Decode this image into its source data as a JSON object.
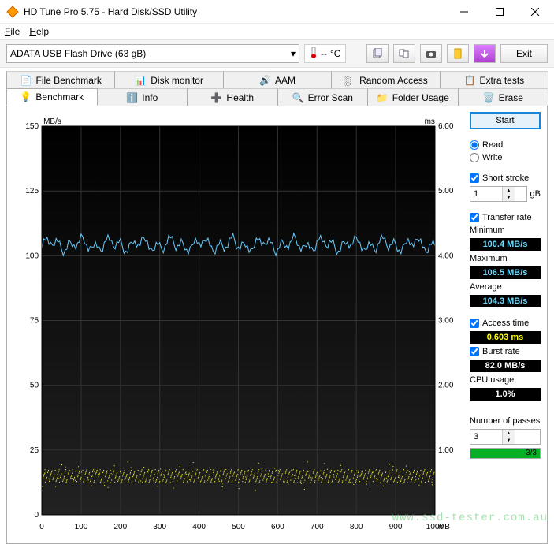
{
  "window": {
    "title": "HD Tune Pro 5.75 - Hard Disk/SSD Utility"
  },
  "menu": {
    "file": "File",
    "help": "Help"
  },
  "toolbar": {
    "device": "ADATA   USB Flash Drive (63 gB)",
    "temp_dash": "--",
    "temp_unit": "°C",
    "exit": "Exit"
  },
  "tabs_top": [
    {
      "label": "File Benchmark"
    },
    {
      "label": "Disk monitor"
    },
    {
      "label": "AAM"
    },
    {
      "label": "Random Access"
    },
    {
      "label": "Extra tests"
    }
  ],
  "tabs_bottom": [
    {
      "label": "Benchmark"
    },
    {
      "label": "Info"
    },
    {
      "label": "Health"
    },
    {
      "label": "Error Scan"
    },
    {
      "label": "Folder Usage"
    },
    {
      "label": "Erase"
    }
  ],
  "side": {
    "start": "Start",
    "read": "Read",
    "write": "Write",
    "short_stroke": "Short stroke",
    "short_stroke_val": "1",
    "short_stroke_unit": "gB",
    "transfer_rate": "Transfer rate",
    "min_label": "Minimum",
    "min_val": "100.4 MB/s",
    "max_label": "Maximum",
    "max_val": "106.5 MB/s",
    "avg_label": "Average",
    "avg_val": "104.3 MB/s",
    "access_time": "Access time",
    "access_val": "0.603 ms",
    "burst_rate": "Burst rate",
    "burst_val": "82.0 MB/s",
    "cpu_label": "CPU usage",
    "cpu_val": "1.0%",
    "passes_label": "Number of passes",
    "passes_val": "3",
    "progress_txt": "3/3"
  },
  "chart_data": {
    "type": "line+scatter",
    "title": "",
    "x_unit": "mB",
    "y_left_label": "MB/s",
    "y_right_label": "ms",
    "x_ticks": [
      0,
      100,
      200,
      300,
      400,
      500,
      600,
      700,
      800,
      900,
      1000
    ],
    "y_left_ticks": [
      0,
      25,
      50,
      75,
      100,
      125,
      150
    ],
    "y_right_ticks": [
      0,
      1.0,
      2.0,
      3.0,
      4.0,
      5.0,
      6.0
    ],
    "xlim": [
      0,
      1000
    ],
    "ylim_left": [
      0,
      150
    ],
    "ylim_right": [
      0,
      6.0
    ],
    "series": [
      {
        "name": "transfer_rate",
        "axis": "left",
        "color": "#66ccff",
        "style": "line",
        "approx_mean": 104.3,
        "approx_min": 100.4,
        "approx_max": 106.5,
        "note": "dense wavy horizontal line near y≈104 across full x range"
      },
      {
        "name": "access_time",
        "axis": "right",
        "color": "#ffff33",
        "style": "scatter",
        "approx_mean_ms": 0.603,
        "note": "dense scatter of points near right-axis ≈0.6 ms across full x range"
      }
    ]
  },
  "watermark": "www.ssd-tester.com.au"
}
